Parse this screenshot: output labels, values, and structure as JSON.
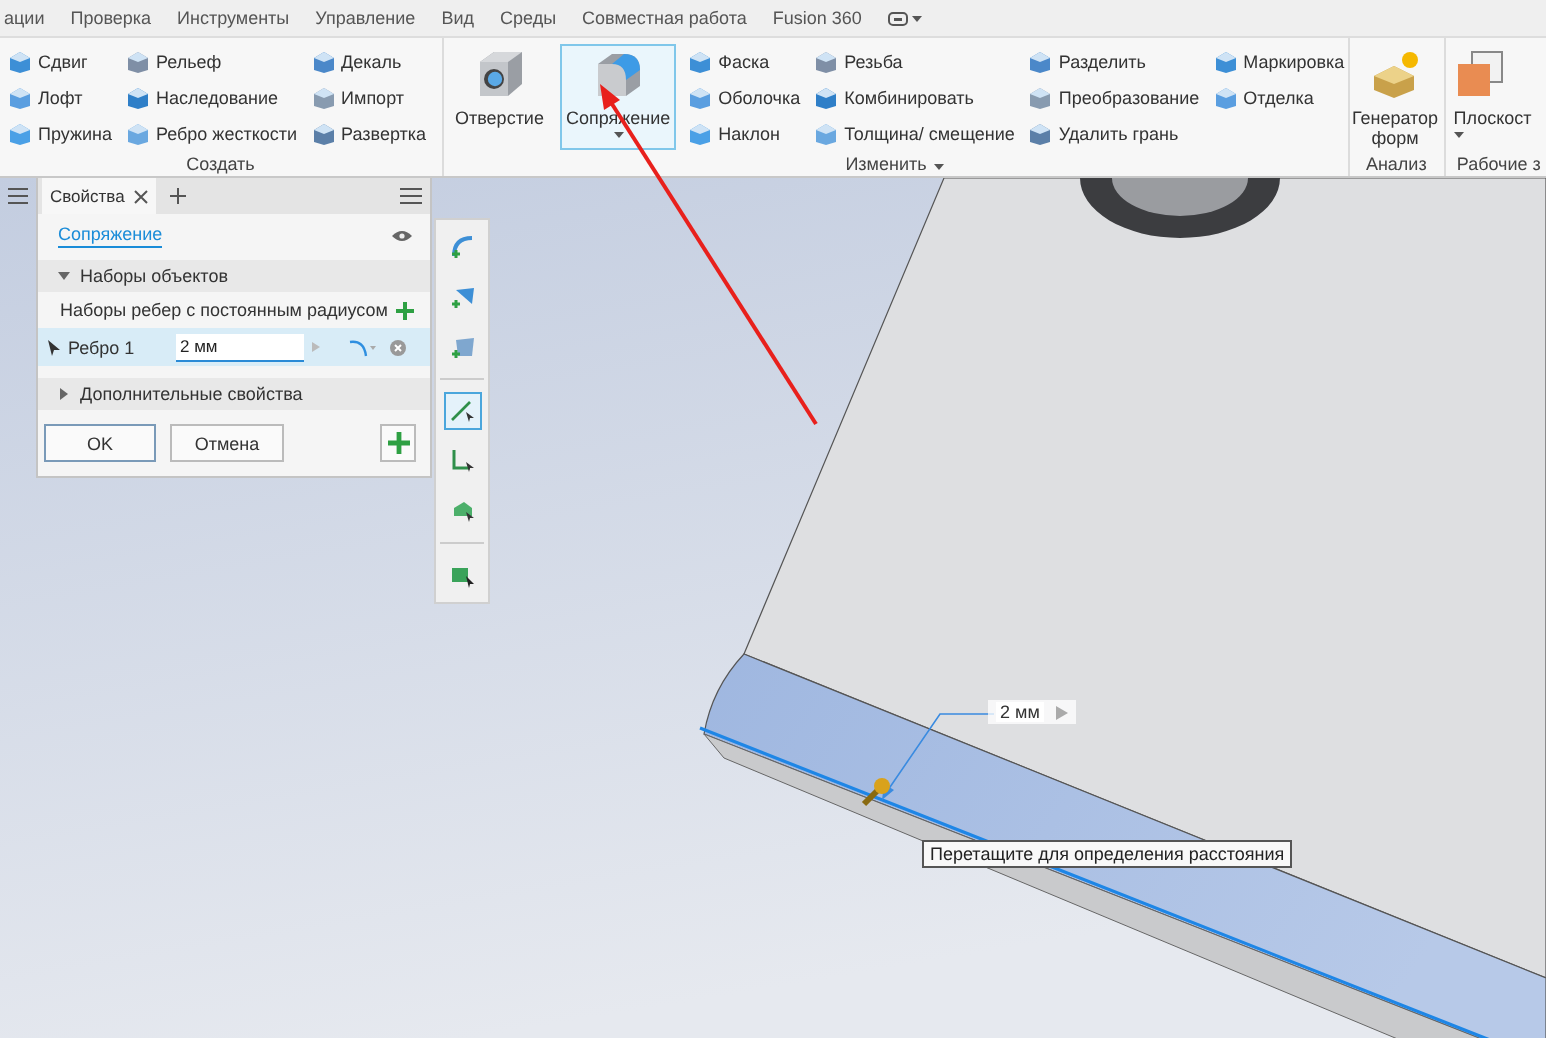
{
  "menu_bar": {
    "items": [
      "ации",
      "Проверка",
      "Инструменты",
      "Управление",
      "Вид",
      "Среды",
      "Совместная работа",
      "Fusion 360"
    ]
  },
  "ribbon": {
    "groups": [
      {
        "label": "Создать",
        "columns": [
          [
            "Сдвиг",
            "Лофт",
            "Пружина"
          ],
          [
            "Рельеф",
            "Наследование",
            "Ребро жесткости"
          ],
          [
            "Декаль",
            "Импорт",
            "Развертка"
          ]
        ]
      },
      {
        "label": "Изменить",
        "has_menu": true,
        "large": [
          {
            "label": "Отверстие",
            "selected": false
          },
          {
            "label": "Сопряжение",
            "selected": true,
            "dropdown": true
          }
        ],
        "columns": [
          [
            "Фаска",
            "Оболочка",
            "Наклон"
          ],
          [
            "Резьба",
            "Комбинировать",
            "Толщина/ смещение"
          ],
          [
            "Разделить",
            "Преобразование",
            "Удалить грань"
          ],
          [
            "Маркировка",
            "Отделка"
          ]
        ]
      },
      {
        "label": "Анализ",
        "large": [
          {
            "label": "Генератор форм",
            "selected": false
          }
        ]
      },
      {
        "label": "Рабочие з",
        "large": [
          {
            "label": "Плоскост",
            "selected": false,
            "dropdown": true
          }
        ]
      }
    ]
  },
  "properties_panel": {
    "tab": "Свойства",
    "feature": "Сопряжение",
    "object_sets": {
      "title": "Наборы объектов",
      "expanded": true,
      "set_label": "Наборы ребер с постоянным радиусом",
      "rows": [
        {
          "name": "Ребро 1",
          "value": "2 мм",
          "selected": true
        }
      ]
    },
    "more": {
      "title": "Дополнительные свойства",
      "expanded": false
    },
    "buttons": [
      "OK",
      "Отмена"
    ]
  },
  "tool_strip": [
    {
      "selected": false
    },
    {
      "selected": false
    },
    {
      "selected": false
    },
    {
      "selected": true
    },
    {
      "selected": false
    },
    {
      "selected": false
    },
    {
      "selected": false
    }
  ],
  "viewport": {
    "dimension": "2 мм",
    "tooltip": "Перетащите для определения расстояния"
  }
}
